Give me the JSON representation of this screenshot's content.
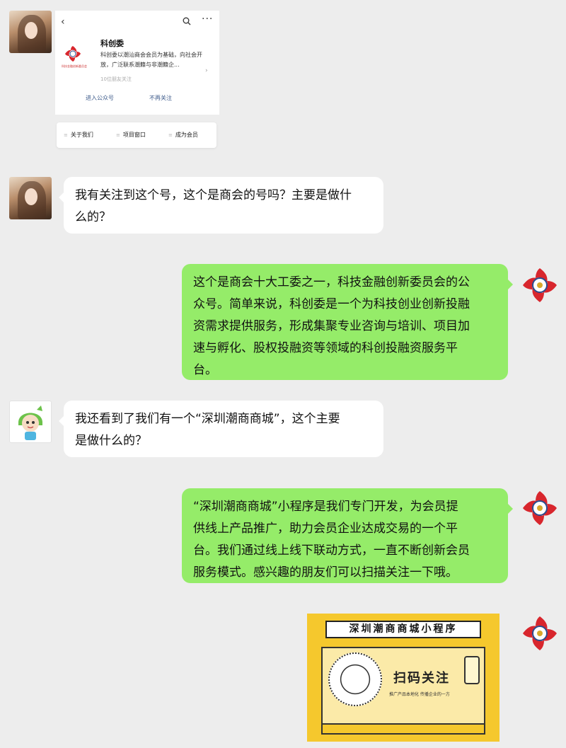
{
  "card": {
    "title": "科创委",
    "description": "科创委以潮汕商会会员为基础，向社会开放，广泛联系潮籍与非潮籍企...",
    "followers": "10位朋友关注",
    "enter_label": "进入公众号",
    "unfollow_label": "不再关注",
    "back_icon": "‹",
    "more_icon": "···",
    "logo_caption": "科技金融创新委员会"
  },
  "menu": {
    "items": [
      "关于我们",
      "项目窗口",
      "成为会员"
    ]
  },
  "messages": [
    {
      "side": "left",
      "text_lines": [
        "我有关注到这个号，这个是商会的号吗？主要是做什",
        "么的？"
      ]
    },
    {
      "side": "right",
      "text_lines": [
        "这个是商会十大工委之一，科技金融创新委员会的公",
        "众号。简单来说，科创委是一个为科技创业创新投融",
        "资需求提供服务，形成集聚专业咨询与培训、项目加",
        "速与孵化、股权投融资等领域的科创投融资服务平",
        "台。"
      ]
    },
    {
      "side": "left",
      "text_lines": [
        "我还看到了我们有一个“深圳潮商商城”，这个主要",
        "是做什么的？"
      ]
    },
    {
      "side": "right",
      "text_lines": [
        "“深圳潮商商城”小程序是我们专门开发，为会员提",
        "供线上产品推广，助力会员企业达成交易的一个平",
        "台。我们通过线上线下联动方式，一直不断创新会员",
        "服务模式。感兴趣的朋友们可以扫描关注一下哦。"
      ]
    }
  ],
  "poster": {
    "title": "深圳潮商商城小程序",
    "cta": "扫码关注",
    "subtitle": "推广产品本地化 传播企业的一方"
  },
  "colors": {
    "bg": "#ededed",
    "green_bubble": "#95ec69",
    "white_bubble": "#ffffff",
    "link": "#3c5a8a",
    "poster": "#f5c82d"
  }
}
